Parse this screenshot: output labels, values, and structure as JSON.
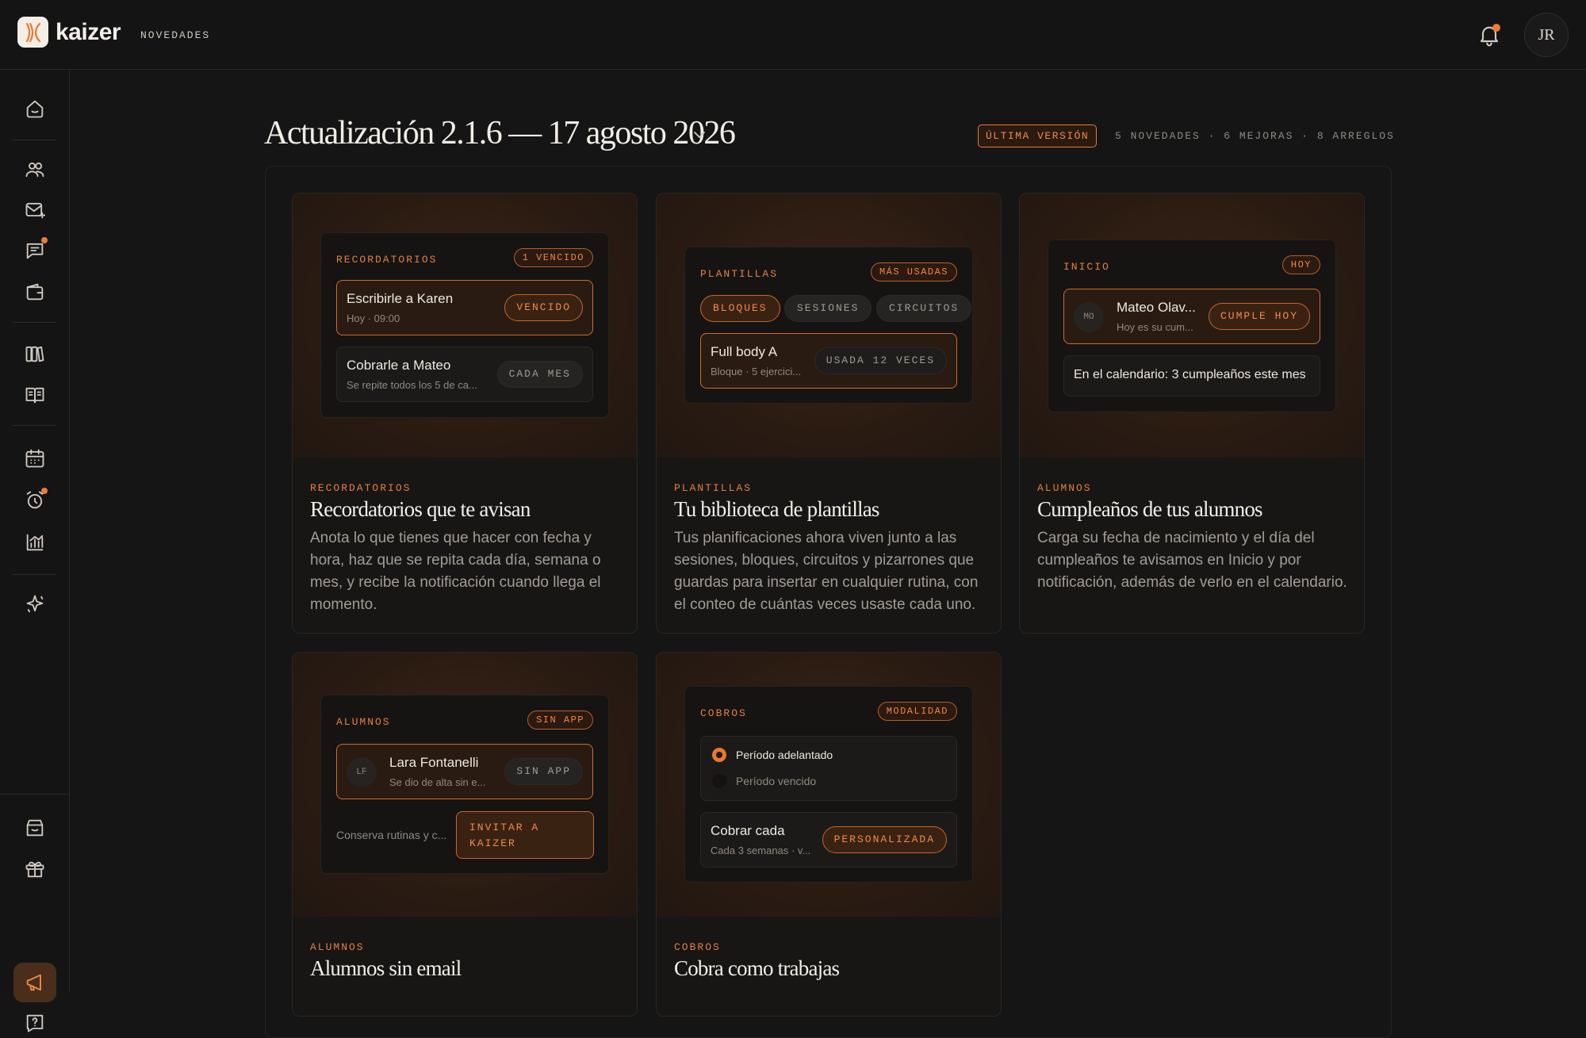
{
  "app": {
    "brand": "kaizer",
    "nav_label": "NOVEDADES",
    "user_initials": "JR"
  },
  "colors": {
    "accent": "#f07b2c",
    "background": "#151515"
  },
  "sidebar": {
    "icons": [
      "home-icon",
      "users-icon",
      "mail-plus-icon",
      "chat-icon",
      "wallet-icon",
      "library-icon",
      "book-icon",
      "calendar-icon",
      "alarm-icon",
      "chart-icon",
      "sparkles-icon",
      "store-icon",
      "gift-icon",
      "megaphone-icon",
      "help-icon"
    ],
    "active": "megaphone-icon"
  },
  "header": {
    "title": "Actualización 2.1.6 — 17 agosto 2026",
    "badge": "ÚLTIMA VERSIÓN",
    "summary": "5 NOVEDADES · 6 MEJORAS · 8 ARREGLOS"
  },
  "cards": [
    {
      "category": "RECORDATORIOS",
      "title": "Recordatorios que te avisan",
      "description": "Anota lo que tienes que hacer con fecha y hora, haz que se repita cada día, semana o mes, y recibe la notificación cuando llega el momento.",
      "preview": {
        "header": "RECORDATORIOS",
        "pill": "1 VENCIDO",
        "rows": [
          {
            "title": "Escribirle a Karen",
            "subtitle": "Hoy · 09:00",
            "action": "VENCIDO"
          },
          {
            "title": "Cobrarle a Mateo",
            "subtitle": "Se repite todos los 5 de ca...",
            "action": "CADA MES"
          }
        ]
      }
    },
    {
      "category": "PLANTILLAS",
      "title": "Tu biblioteca de plantillas",
      "description": "Tus planificaciones ahora viven junto a las sesiones, bloques, circuitos y pizarrones que guardas para insertar en cualquier rutina, con el conteo de cuántas veces usaste cada uno.",
      "preview": {
        "header": "PLANTILLAS",
        "pill": "MÁS USADAS",
        "tabs": [
          "BLOQUES",
          "SESIONES",
          "CIRCUITOS"
        ],
        "row": {
          "title": "Full body A",
          "subtitle": "Bloque · 5 ejercici...",
          "action": "USADA 12 VECES"
        }
      }
    },
    {
      "category": "ALUMNOS",
      "title": "Cumpleaños de tus alumnos",
      "description": "Carga su fecha de nacimiento y el día del cumpleaños te avisamos en Inicio y por notificación, además de verlo en el calendario.",
      "preview": {
        "header": "INICIO",
        "pill": "HOY",
        "row": {
          "initials": "MO",
          "title": "Mateo Olav...",
          "subtitle": "Hoy es su cum...",
          "action": "CUMPLE HOY"
        },
        "note": "En el calendario: 3 cumpleaños este mes"
      }
    },
    {
      "category": "ALUMNOS",
      "title": "Alumnos sin email",
      "preview": {
        "header": "ALUMNOS",
        "pill": "SIN APP",
        "row": {
          "initials": "LF",
          "title": "Lara Fontanelli",
          "subtitle": "Se dio de alta sin e...",
          "action": "SIN APP"
        },
        "footer_text": "Conserva rutinas y c...",
        "footer_action": "INVITAR A KAIZER"
      }
    },
    {
      "category": "COBROS",
      "title": "Cobra como trabajas",
      "preview": {
        "header": "COBROS",
        "pill": "MODALIDAD",
        "options": [
          {
            "label": "Período adelantado",
            "selected": true
          },
          {
            "label": "Período vencido",
            "selected": false
          }
        ],
        "row": {
          "title": "Cobrar cada",
          "subtitle": "Cada 3 semanas · v...",
          "action": "PERSONALIZADA"
        }
      }
    }
  ]
}
